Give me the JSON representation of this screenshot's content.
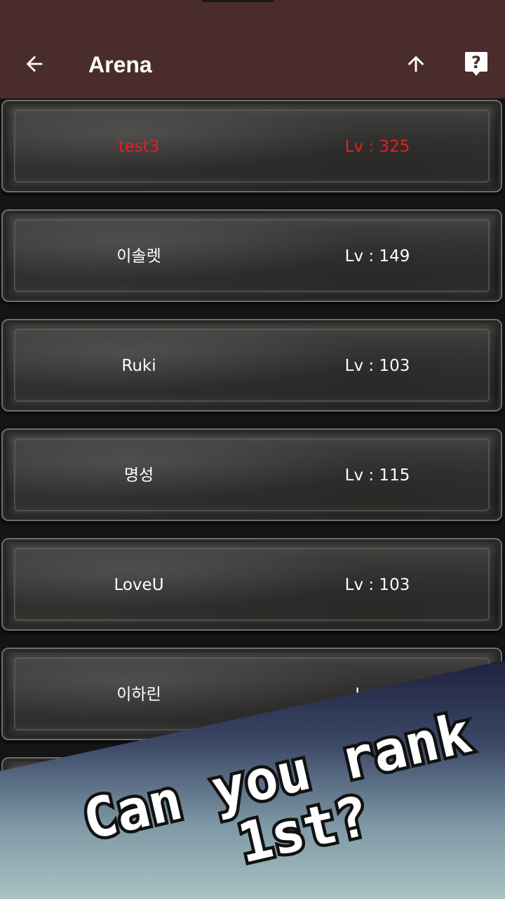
{
  "appbar": {
    "title": "Arena",
    "back_icon": "arrow-left-icon",
    "scroll_top_icon": "arrow-up-icon",
    "help_icon": "help-icon"
  },
  "ranking": [
    {
      "name": "test3",
      "level": "Lv : 325",
      "highlight": true
    },
    {
      "name": "이솔렛",
      "level": "Lv : 149",
      "highlight": false
    },
    {
      "name": "Ruki",
      "level": "Lv : 103",
      "highlight": false
    },
    {
      "name": "명성",
      "level": "Lv : 115",
      "highlight": false
    },
    {
      "name": "LoveU",
      "level": "Lv : 103",
      "highlight": false
    },
    {
      "name": "이하린",
      "level": "Lv : 1",
      "highlight": false
    }
  ],
  "promo": {
    "line1": "Can you rank",
    "line2": "1st?"
  },
  "colors": {
    "appbar": "#4a2d2a",
    "highlight": "#e02020",
    "text": "#ffffff"
  }
}
